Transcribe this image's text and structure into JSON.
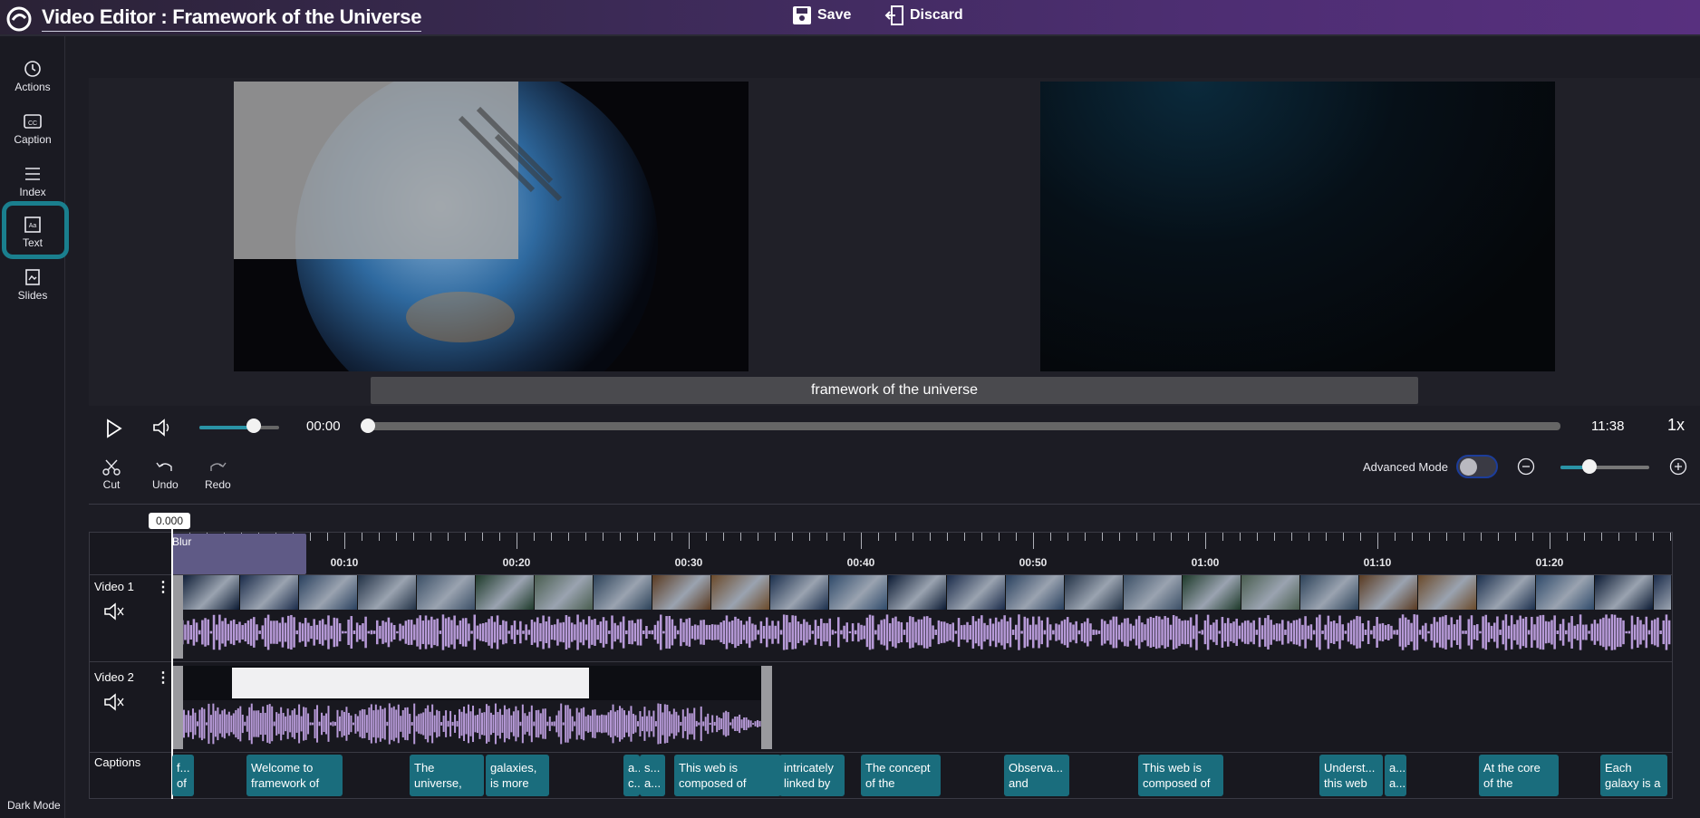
{
  "header": {
    "title": "Video Editor : Framework of the Universe",
    "save_label": "Save",
    "discard_label": "Discard"
  },
  "sidebar": {
    "items": [
      {
        "label": "Actions",
        "icon": "history-icon"
      },
      {
        "label": "Caption",
        "icon": "cc-icon"
      },
      {
        "label": "Index",
        "icon": "list-icon"
      },
      {
        "label": "Text",
        "icon": "text-icon",
        "active": true
      },
      {
        "label": "Slides",
        "icon": "slides-icon"
      }
    ],
    "dark_mode_label": "Dark Mode"
  },
  "preview": {
    "caption_text": "framework of the universe"
  },
  "player": {
    "current_time": "00:00",
    "total_time": "11:38",
    "speed": "1x",
    "volume_fraction": 0.68,
    "progress_fraction": 0.0
  },
  "tools": {
    "cut_label": "Cut",
    "undo_label": "Undo",
    "redo_label": "Redo",
    "advanced_mode_label": "Advanced Mode",
    "advanced_mode_on": false,
    "zoom_fraction": 0.33
  },
  "timeline": {
    "timecode": "0.000",
    "blur_label": "Blur",
    "ticks": [
      "00:10",
      "00:20",
      "00:30",
      "00:40",
      "00:50",
      "01:00",
      "01:10",
      "01:20"
    ],
    "tracks": {
      "video1_label": "Video 1",
      "video2_label": "Video 2",
      "captions_label": "Captions"
    },
    "captions": [
      {
        "text": "f...\nof"
      },
      {
        "text": "Welcome to\nframework of"
      },
      {
        "text": "The\nuniverse,"
      },
      {
        "text": "galaxies,\nis more"
      },
      {
        "text": "a...\nc..."
      },
      {
        "text": "s...\na..."
      },
      {
        "text": "This web is\ncomposed of"
      },
      {
        "text": "intricately\nlinked by"
      },
      {
        "text": "The concept\nof the"
      },
      {
        "text": "Observa...\nand"
      },
      {
        "text": "This web is\ncomposed of"
      },
      {
        "text": "Underst...\nthis web"
      },
      {
        "text": "a...\na..."
      },
      {
        "text": "At the core\nof the"
      },
      {
        "text": "Each\ngalaxy is a"
      }
    ]
  },
  "colors": {
    "accent": "#1a7f8e",
    "caption_block": "#1a6d7d",
    "waveform": "#b79ad8",
    "blur_block": "#5f5a86"
  }
}
